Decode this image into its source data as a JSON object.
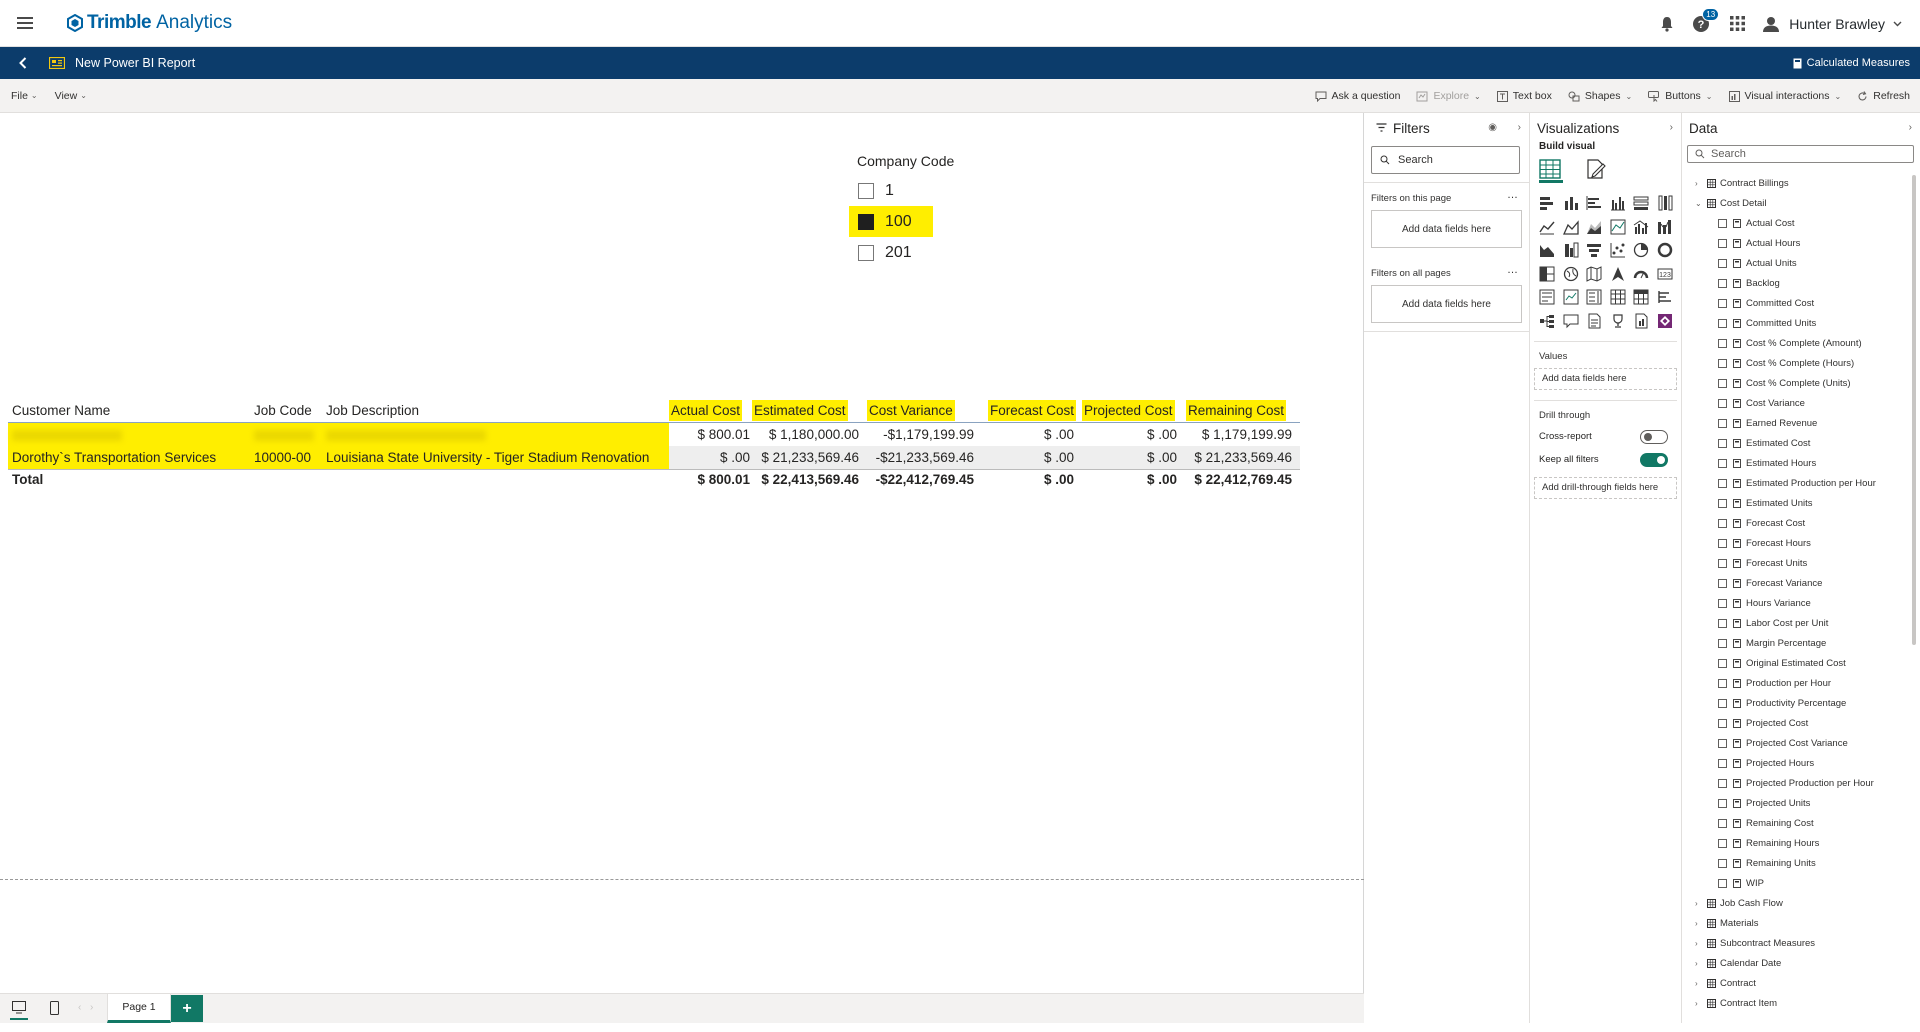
{
  "app": {
    "brand": "Trimble",
    "product": "Analytics",
    "help_badge": "13",
    "user_name": "Hunter Brawley"
  },
  "titlebar": {
    "report_title": "New Power BI Report",
    "calc_measures": "Calculated Measures"
  },
  "ribbon": {
    "menus": [
      "File",
      "View"
    ],
    "buttons": [
      "Ask a question",
      "Explore",
      "Text box",
      "Shapes",
      "Buttons",
      "Visual interactions",
      "Refresh"
    ]
  },
  "slicer": {
    "title": "Company Code",
    "options": [
      "1",
      "100",
      "201"
    ],
    "selected": "100"
  },
  "table": {
    "columns": [
      "Customer Name",
      "Job Code",
      "Job Description",
      "Actual Cost",
      "Estimated Cost",
      "Cost Variance",
      "Forecast Cost",
      "Projected Cost",
      "Remaining Cost"
    ],
    "rows": [
      {
        "customer": "",
        "job_code": "",
        "job_description": "",
        "actual": "$ 800.01",
        "estimated": "$ 1,180,000.00",
        "variance": "-$1,179,199.99",
        "forecast": "$ .00",
        "projected": "$ .00",
        "remaining": "$ 1,179,199.99"
      },
      {
        "customer": "Dorothy`s Transportation Services",
        "job_code": "10000-00",
        "job_description": "Louisiana State University - Tiger Stadium Renovation",
        "actual": "$ .00",
        "estimated": "$ 21,233,569.46",
        "variance": "-$21,233,569.46",
        "forecast": "$ .00",
        "projected": "$ .00",
        "remaining": "$ 21,233,569.46"
      }
    ],
    "total": {
      "label": "Total",
      "actual": "$ 800.01",
      "estimated": "$ 22,413,569.46",
      "variance": "-$22,412,769.45",
      "forecast": "$ .00",
      "projected": "$ .00",
      "remaining": "$ 22,412,769.45"
    }
  },
  "filters": {
    "title": "Filters",
    "search": "Search",
    "on_page": "Filters on this page",
    "on_all": "Filters on all pages",
    "add_fields": "Add data fields here"
  },
  "viz": {
    "title": "Visualizations",
    "build": "Build visual",
    "values": "Values",
    "add_fields": "Add data fields here",
    "drill": "Drill through",
    "cross_report": "Cross-report",
    "keep_filters": "Keep all filters",
    "add_drill": "Add drill-through fields here"
  },
  "data": {
    "title": "Data",
    "search": "Search",
    "tables_before": [
      "Contract Billings"
    ],
    "open_table": "Cost Detail",
    "fields": [
      "Actual Cost",
      "Actual Hours",
      "Actual Units",
      "Backlog",
      "Committed Cost",
      "Committed Units",
      "Cost % Complete (Amount)",
      "Cost % Complete (Hours)",
      "Cost % Complete (Units)",
      "Cost Variance",
      "Earned Revenue",
      "Estimated Cost",
      "Estimated Hours",
      "Estimated Production per Hour",
      "Estimated Units",
      "Forecast Cost",
      "Forecast Hours",
      "Forecast Units",
      "Forecast Variance",
      "Hours Variance",
      "Labor Cost per Unit",
      "Margin Percentage",
      "Original Estimated Cost",
      "Production per Hour",
      "Productivity Percentage",
      "Projected Cost",
      "Projected Cost Variance",
      "Projected Hours",
      "Projected Production per Hour",
      "Projected Units",
      "Remaining Cost",
      "Remaining Hours",
      "Remaining Units",
      "WIP"
    ],
    "tables_after": [
      "Job Cash Flow",
      "Materials",
      "Subcontract Measures",
      "Calendar Date",
      "Contract",
      "Contract Item"
    ]
  },
  "pages": {
    "tab": "Page 1",
    "add": "+"
  },
  "colors": {
    "brand_blue": "#0063a3",
    "title_bar": "#0c3c6b",
    "highlight": "#ffee00",
    "accent_green": "#117865"
  }
}
